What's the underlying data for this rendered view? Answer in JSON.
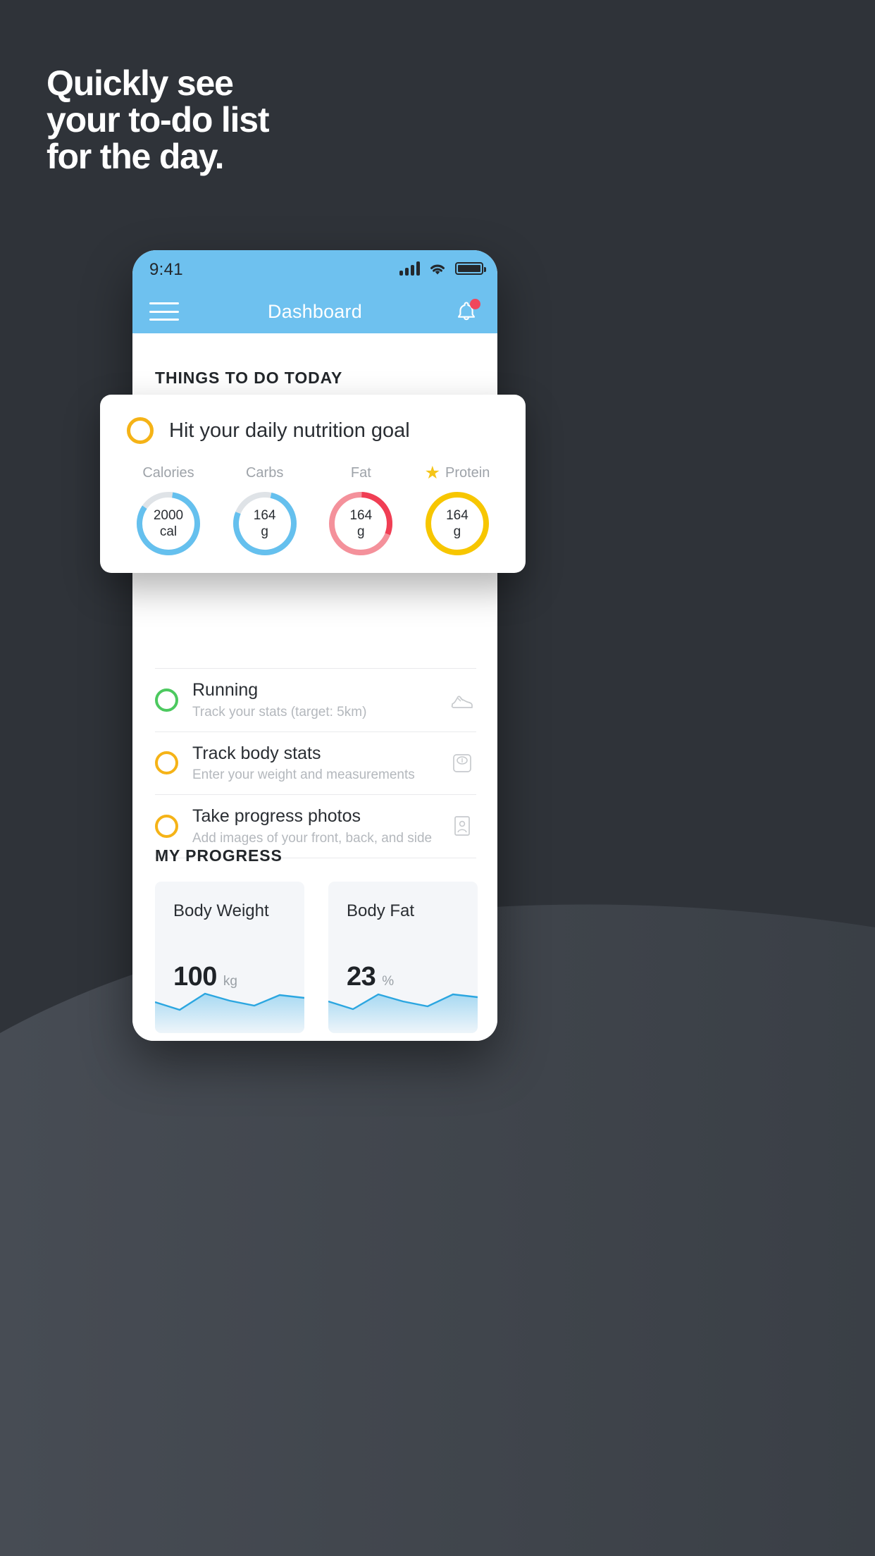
{
  "promo": {
    "headline": "Quickly see\nyour to-do list\nfor the day.",
    "background_color": "#2f3339",
    "accent_blue": "#6ec1ef"
  },
  "phone": {
    "status_bar": {
      "time": "9:41",
      "signal_icon": "signal-bars-icon",
      "wifi_icon": "wifi-icon",
      "battery_icon": "battery-icon"
    },
    "navbar": {
      "menu_icon": "hamburger-menu-icon",
      "title": "Dashboard",
      "notification_icon": "bell-icon",
      "notification_badge": true
    },
    "sections": {
      "things_title": "THINGS TO DO TODAY",
      "progress_title": "MY PROGRESS"
    },
    "todos": [
      {
        "title": "Running",
        "subtitle": "Track your stats (target: 5km)",
        "ring_color": "#4cc95f",
        "icon": "running-shoe-icon"
      },
      {
        "title": "Track body stats",
        "subtitle": "Enter your weight and measurements",
        "ring_color": "#f5b317",
        "icon": "weight-scale-icon"
      },
      {
        "title": "Take progress photos",
        "subtitle": "Add images of your front, back, and side",
        "ring_color": "#f5b317",
        "icon": "portrait-photo-icon"
      }
    ],
    "progress_cards": [
      {
        "label": "Body Weight",
        "value": "100",
        "unit": "kg"
      },
      {
        "label": "Body Fat",
        "value": "23",
        "unit": "%"
      }
    ]
  },
  "nutrition_card": {
    "ring_color": "#f5b317",
    "title": "Hit your daily nutrition goal",
    "macros": [
      {
        "label": "Calories",
        "value": "2000",
        "unit": "cal",
        "color": "#65c0ee",
        "track": "#dfe3e7",
        "percent": 82,
        "starred": false
      },
      {
        "label": "Carbs",
        "value": "164",
        "unit": "g",
        "color": "#65c0ee",
        "track": "#dfe3e7",
        "percent": 78,
        "starred": false
      },
      {
        "label": "Fat",
        "value": "164",
        "unit": "g",
        "color": "#f4848f",
        "track": "#f4848f",
        "percent": 30,
        "starred": false
      },
      {
        "label": "Protein",
        "value": "164",
        "unit": "g",
        "color": "#f7c600",
        "track": "#f7c600",
        "percent": 100,
        "starred": true,
        "star_icon": "star-icon"
      }
    ]
  },
  "chart_data": [
    {
      "type": "area",
      "title": "Body Weight",
      "ylabel": "kg",
      "x": [
        0,
        1,
        2,
        3,
        4,
        5,
        6
      ],
      "values": [
        58,
        42,
        78,
        62,
        50,
        72,
        68
      ],
      "line_color": "#2ba6e0",
      "fill_color": "#bfe2f5"
    },
    {
      "type": "area",
      "title": "Body Fat",
      "ylabel": "%",
      "x": [
        0,
        1,
        2,
        3,
        4,
        5,
        6
      ],
      "values": [
        60,
        44,
        76,
        60,
        48,
        74,
        70
      ],
      "line_color": "#2ba6e0",
      "fill_color": "#bfe2f5"
    }
  ]
}
